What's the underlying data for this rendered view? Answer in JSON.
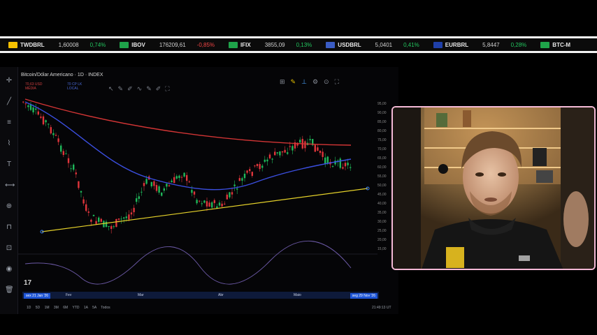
{
  "ticker": [
    {
      "symbol": "TWDBRL",
      "price": "1,60008",
      "change": "0,74%",
      "dir": "up",
      "flag_color": "#f5c000"
    },
    {
      "symbol": "IBOV",
      "price": "176209,61",
      "change": "-0,85%",
      "dir": "dn",
      "flag_color": "#1fa34a"
    },
    {
      "symbol": "IFIX",
      "price": "3855,09",
      "change": "0,13%",
      "dir": "up",
      "flag_color": "#1fa34a"
    },
    {
      "symbol": "USDBRL",
      "price": "5,0401",
      "change": "0,41%",
      "dir": "up",
      "flag_color": "#3a5cc4"
    },
    {
      "symbol": "EURBRL",
      "price": "5,8447",
      "change": "0,28%",
      "dir": "up",
      "flag_color": "#1f3fa8"
    },
    {
      "symbol": "BTC-M",
      "price": "",
      "change": "",
      "dir": "up",
      "flag_color": "#1fa34a"
    }
  ],
  "chart": {
    "title": "Bitcoin/Dólar Americano · 1D · INDEX",
    "legend_red": [
      "70,63 USD",
      "MÉDIA"
    ],
    "legend_blue": [
      "70 CP LK",
      "LOCAL"
    ],
    "price_ticks": [
      "95,00",
      "90,00",
      "85,00",
      "80,00",
      "75,00",
      "70,00",
      "65,00",
      "60,00",
      "55,00",
      "50,00",
      "45,00",
      "40,00",
      "35,00",
      "30,00",
      "25,00",
      "20,00",
      "15,00"
    ],
    "date_start": "sex 21 Jan '26",
    "date_end": "seg 29 Nov '26",
    "date_ticks": [
      "Fev",
      "Mar",
      "Abr",
      "Maio"
    ],
    "ranges": [
      "1D",
      "5D",
      "1M",
      "3M",
      "6M",
      "YTD",
      "1A",
      "5A",
      "Todos"
    ],
    "clock": "21:49:13 UT"
  },
  "icons": {
    "left_toolbar": [
      "crosshair-icon",
      "trend-line-icon",
      "fib-icon",
      "pattern-icon",
      "text-icon",
      "measure-icon",
      "zoom-icon",
      "magnet-icon",
      "lock-icon",
      "eye-icon",
      "trash-icon"
    ],
    "top_toolbar": [
      "indicator-icon",
      "pencil-icon",
      "line-icon",
      "settings-icon",
      "camera-icon",
      "fullscreen-icon"
    ]
  },
  "colors": {
    "ma_red": "#d33535",
    "ma_blue": "#3b4fe0",
    "trend_yellow": "#e6d22a",
    "candle_up": "#1fb85a",
    "candle_down": "#e0353b",
    "cam_border": "#f4b9d6"
  }
}
